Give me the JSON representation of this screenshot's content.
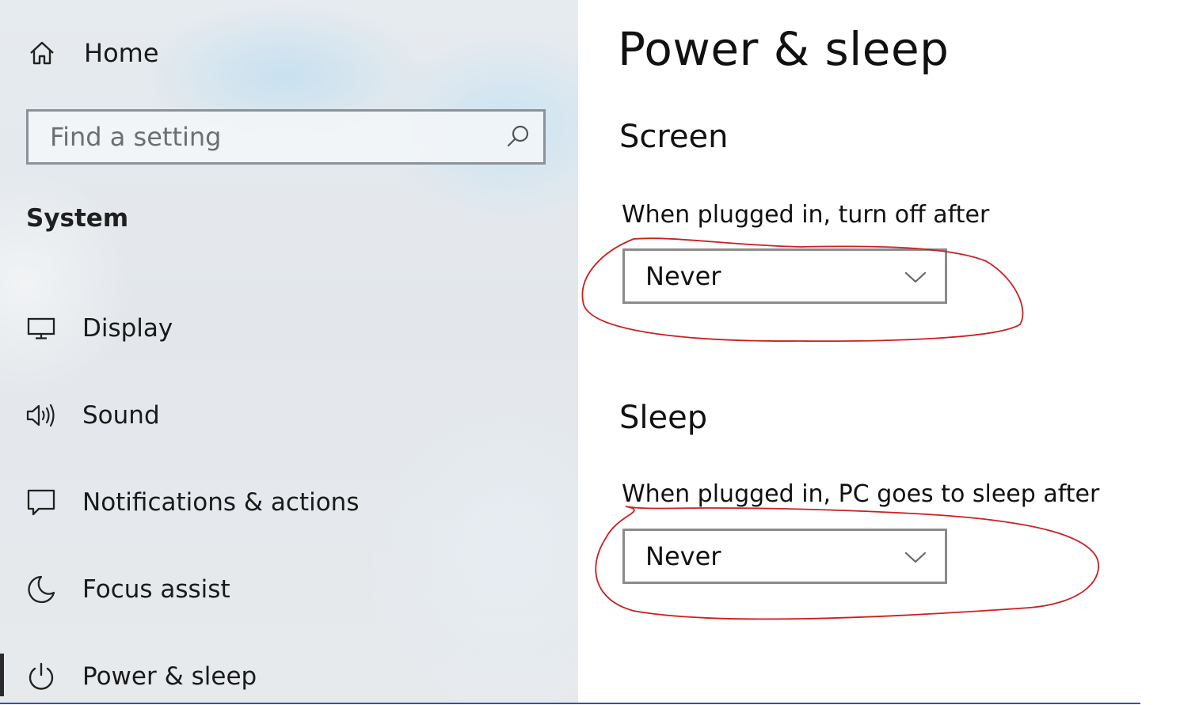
{
  "sidebar": {
    "home": {
      "label": "Home",
      "icon": "home-icon"
    },
    "search": {
      "placeholder": "Find a setting",
      "icon": "search-icon"
    },
    "section_title": "System",
    "items": [
      {
        "label": "Display",
        "icon": "monitor-icon"
      },
      {
        "label": "Sound",
        "icon": "speaker-icon"
      },
      {
        "label": "Notifications & actions",
        "icon": "notification-icon"
      },
      {
        "label": "Focus assist",
        "icon": "moon-icon"
      },
      {
        "label": "Power & sleep",
        "icon": "power-icon",
        "selected": true
      }
    ]
  },
  "main": {
    "title": "Power & sleep",
    "screen": {
      "heading": "Screen",
      "label": "When plugged in, turn off after",
      "value": "Never"
    },
    "sleep": {
      "heading": "Sleep",
      "label": "When plugged in, PC goes to sleep after",
      "value": "Never"
    }
  },
  "colors": {
    "annotation": "#cc1f1f",
    "dropdown_border": "#8b8b8b",
    "selection_bar": "#2b2b2b"
  }
}
